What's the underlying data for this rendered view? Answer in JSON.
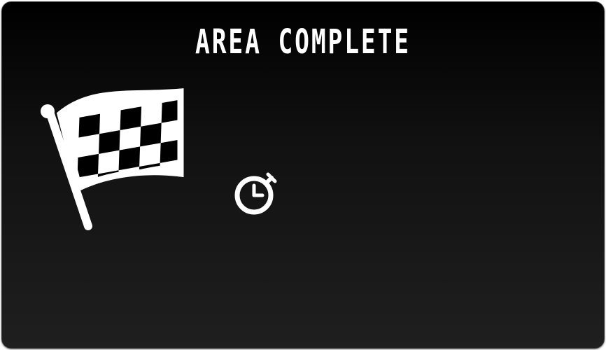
{
  "screen": {
    "title": "AREA COMPLETE"
  },
  "icons": {
    "finish": "checkered-flag-icon",
    "time": "stopwatch-icon"
  },
  "colors": {
    "text": "#ffffff",
    "panel_top": "#000000",
    "panel_bottom": "#1f1f1f"
  }
}
